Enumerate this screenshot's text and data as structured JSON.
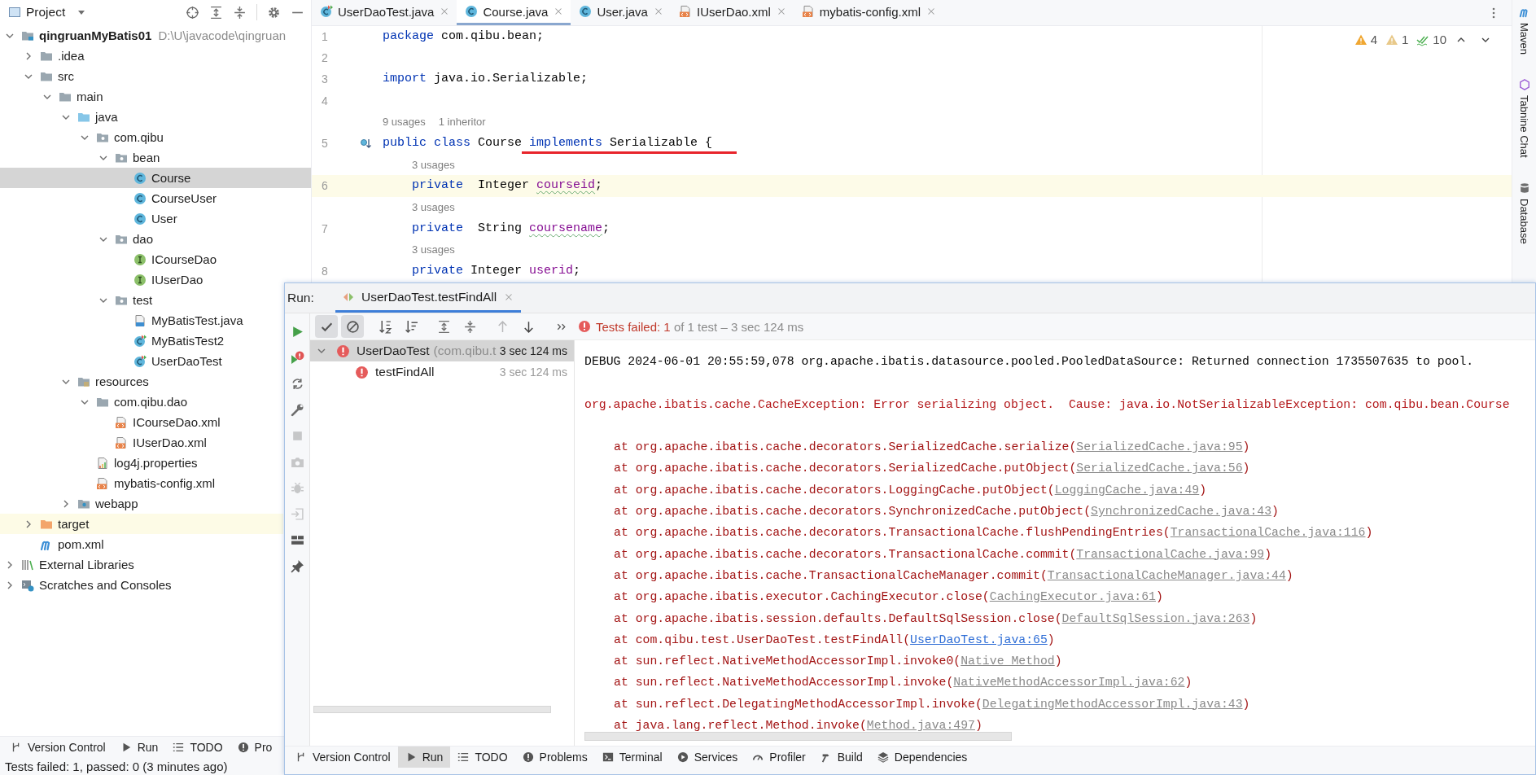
{
  "project_panel": {
    "title": "Project",
    "tree": [
      {
        "label": "qingruanMyBatis01",
        "hint": "D:\\U\\javacode\\qingruan",
        "kind": "module",
        "expanded": true,
        "selected": false,
        "highlighted": false,
        "children": [
          {
            "label": ".idea",
            "kind": "folder",
            "expanded": false,
            "selected": false,
            "highlighted": false
          },
          {
            "label": "src",
            "kind": "folder",
            "expanded": true,
            "selected": false,
            "highlighted": false,
            "children": [
              {
                "label": "main",
                "kind": "folder",
                "expanded": true,
                "selected": false,
                "highlighted": false,
                "children": [
                  {
                    "label": "java",
                    "kind": "source",
                    "expanded": true,
                    "selected": false,
                    "highlighted": false,
                    "children": [
                      {
                        "label": "com.qibu",
                        "kind": "package",
                        "expanded": true,
                        "selected": false,
                        "highlighted": false,
                        "children": [
                          {
                            "label": "bean",
                            "kind": "package",
                            "expanded": true,
                            "selected": false,
                            "highlighted": false,
                            "children": [
                              {
                                "label": "Course",
                                "kind": "class",
                                "selected": true,
                                "highlighted": false
                              },
                              {
                                "label": "CourseUser",
                                "kind": "class",
                                "selected": false,
                                "highlighted": false
                              },
                              {
                                "label": "User",
                                "kind": "class",
                                "selected": false,
                                "highlighted": false
                              }
                            ]
                          },
                          {
                            "label": "dao",
                            "kind": "package",
                            "expanded": true,
                            "selected": false,
                            "highlighted": false,
                            "children": [
                              {
                                "label": "ICourseDao",
                                "kind": "interface",
                                "selected": false,
                                "highlighted": false
                              },
                              {
                                "label": "IUserDao",
                                "kind": "interface",
                                "selected": false,
                                "highlighted": false
                              }
                            ]
                          },
                          {
                            "label": "test",
                            "kind": "package",
                            "expanded": true,
                            "selected": false,
                            "highlighted": false,
                            "children": [
                              {
                                "label": "MyBatisTest.java",
                                "kind": "java-file",
                                "selected": false,
                                "highlighted": false
                              },
                              {
                                "label": "MyBatisTest2",
                                "kind": "test-class",
                                "selected": false,
                                "highlighted": false
                              },
                              {
                                "label": "UserDaoTest",
                                "kind": "test-class",
                                "selected": false,
                                "highlighted": false
                              }
                            ]
                          }
                        ]
                      }
                    ]
                  },
                  {
                    "label": "resources",
                    "kind": "resources",
                    "expanded": true,
                    "selected": false,
                    "highlighted": false,
                    "children": [
                      {
                        "label": "com.qibu.dao",
                        "kind": "folder",
                        "expanded": true,
                        "selected": false,
                        "highlighted": false,
                        "children": [
                          {
                            "label": "ICourseDao.xml",
                            "kind": "xml",
                            "selected": false,
                            "highlighted": false
                          },
                          {
                            "label": "IUserDao.xml",
                            "kind": "xml",
                            "selected": false,
                            "highlighted": false
                          }
                        ]
                      },
                      {
                        "label": "log4j.properties",
                        "kind": "properties",
                        "selected": false,
                        "highlighted": false
                      },
                      {
                        "label": "mybatis-config.xml",
                        "kind": "xml",
                        "selected": false,
                        "highlighted": false
                      }
                    ]
                  },
                  {
                    "label": "webapp",
                    "kind": "web",
                    "expanded": false,
                    "selected": false,
                    "highlighted": false
                  }
                ]
              }
            ]
          },
          {
            "label": "target",
            "kind": "excluded",
            "expanded": false,
            "selected": false,
            "highlighted": true
          },
          {
            "label": "pom.xml",
            "kind": "maven",
            "selected": false,
            "highlighted": false
          }
        ]
      },
      {
        "label": "External Libraries",
        "kind": "libraries",
        "expanded": false,
        "selected": false,
        "highlighted": false
      },
      {
        "label": "Scratches and Consoles",
        "kind": "scratches",
        "expanded": false,
        "selected": false,
        "highlighted": false
      }
    ]
  },
  "editor": {
    "tabs": [
      {
        "label": "UserDaoTest.java",
        "kind": "test-class",
        "selected": false
      },
      {
        "label": "Course.java",
        "kind": "class",
        "selected": true
      },
      {
        "label": "User.java",
        "kind": "class",
        "selected": false
      },
      {
        "label": "IUserDao.xml",
        "kind": "xml",
        "selected": false
      },
      {
        "label": "mybatis-config.xml",
        "kind": "xml",
        "selected": false
      }
    ],
    "rows": [
      {
        "kind": "code",
        "number": "1",
        "current": false,
        "marker": false,
        "tokens": [
          {
            "text": "package",
            "kind": "keyword"
          },
          {
            "text": " com.qibu.bean;",
            "kind": "plain"
          }
        ]
      },
      {
        "kind": "code",
        "number": "2",
        "current": false,
        "marker": false
      },
      {
        "kind": "code",
        "number": "3",
        "current": false,
        "marker": false,
        "tokens": [
          {
            "text": "import",
            "kind": "keyword"
          },
          {
            "text": " java.io.Serializable;",
            "kind": "plain"
          }
        ]
      },
      {
        "kind": "code",
        "number": "4",
        "current": false,
        "marker": false
      },
      {
        "kind": "hint",
        "parts": [
          "9 usages",
          "1 inheritor"
        ]
      },
      {
        "kind": "code",
        "number": "5",
        "current": false,
        "marker": true,
        "tokens": [
          {
            "text": "public class",
            "kind": "keyword"
          },
          {
            "text": " Course",
            "kind": "plain"
          }
        ],
        "marked_tokens": [
          {
            "text": " implements",
            "kind": "keyword"
          },
          {
            "text": " Serializable {",
            "kind": "plain"
          }
        ],
        "children": [
          {
            "kind": "hint",
            "parts": [
              "3 usages"
            ]
          },
          {
            "kind": "code",
            "number": "6",
            "current": true,
            "marker": false,
            "tokens": [
              {
                "text": "private",
                "kind": "keyword"
              },
              {
                "text": "  Integer ",
                "kind": "plain"
              },
              {
                "text": "courseid",
                "kind": "field-typo"
              },
              {
                "text": ";",
                "kind": "plain"
              }
            ]
          },
          {
            "kind": "hint",
            "parts": [
              "3 usages"
            ]
          },
          {
            "kind": "code",
            "number": "7",
            "current": false,
            "marker": false,
            "tokens": [
              {
                "text": "private",
                "kind": "keyword"
              },
              {
                "text": "  String ",
                "kind": "plain"
              },
              {
                "text": "coursename",
                "kind": "field-typo"
              },
              {
                "text": ";",
                "kind": "plain"
              }
            ]
          },
          {
            "kind": "hint",
            "parts": [
              "3 usages"
            ]
          },
          {
            "kind": "code",
            "number": "8",
            "current": false,
            "marker": false,
            "tokens": [
              {
                "text": "private",
                "kind": "keyword"
              },
              {
                "text": " Integer ",
                "kind": "plain"
              },
              {
                "text": "userid",
                "kind": "field"
              },
              {
                "text": ";",
                "kind": "plain"
              }
            ]
          }
        ]
      }
    ],
    "inspections": {
      "warnings": "4",
      "weak_warnings": "1",
      "passed": "10"
    }
  },
  "right_strip": [
    {
      "label": "Maven",
      "kind": "maven"
    },
    {
      "label": "Tabnine Chat",
      "kind": "tabnine"
    },
    {
      "label": "Database",
      "kind": "database"
    }
  ],
  "run_window": {
    "title": "Run:",
    "tab": {
      "label": "UserDaoTest.testFindAll",
      "selected": true
    },
    "side_tools": [
      {
        "kind": "run",
        "disabled": false
      },
      {
        "kind": "rerun-failed",
        "disabled": false
      },
      {
        "kind": "toggle-auto",
        "disabled": false
      },
      {
        "kind": "wrench",
        "disabled": false
      },
      {
        "kind": "stop",
        "disabled": true
      },
      {
        "kind": "camera",
        "disabled": true
      },
      {
        "kind": "bug",
        "disabled": true
      },
      {
        "kind": "import",
        "disabled": true
      },
      {
        "kind": "layout",
        "disabled": false
      },
      {
        "kind": "pin",
        "disabled": false
      }
    ],
    "test_tools": [
      {
        "kind": "check",
        "on": true,
        "disabled": false
      },
      {
        "kind": "cancel",
        "on": true,
        "disabled": false
      },
      {
        "kind": "sort-alpha",
        "on": false,
        "disabled": false
      },
      {
        "kind": "sort-duration",
        "on": false,
        "disabled": false
      },
      {
        "kind": "expand-all",
        "on": false,
        "disabled": false
      },
      {
        "kind": "collapse-all",
        "on": false,
        "disabled": false
      },
      {
        "kind": "up",
        "on": false,
        "disabled": true
      },
      {
        "kind": "down",
        "on": false,
        "disabled": false
      },
      {
        "kind": "more",
        "on": false,
        "disabled": false
      }
    ],
    "status": {
      "failed": "Tests failed: 1",
      "summary": "of 1 test – 3 sec 124 ms"
    },
    "tests": [
      {
        "name": "UserDaoTest",
        "package": "(com.qibu.t",
        "time": "3 sec 124 ms",
        "failed": true,
        "expanded": true,
        "selected": true,
        "children": [
          {
            "name": "testFindAll",
            "time": "3 sec 124 ms",
            "failed": true,
            "selected": false
          }
        ]
      }
    ],
    "console": [
      {
        "kind": "debug",
        "text": "DEBUG 2024-06-01 20:55:59,078 org.apache.ibatis.datasource.pooled.PooledDataSource: Returned connection 1735507635 to pool."
      },
      {
        "kind": "blank"
      },
      {
        "kind": "error",
        "text": "org.apache.ibatis.cache.CacheException: Error serializing object.  Cause: java.io.NotSerializableException: com.qibu.bean.Course"
      },
      {
        "kind": "blank"
      },
      {
        "kind": "trace",
        "text": "at org.apache.ibatis.cache.decorators.SerializedCache.serialize(",
        "link": "SerializedCache.java:95",
        "close": ")",
        "project": false
      },
      {
        "kind": "trace",
        "text": "at org.apache.ibatis.cache.decorators.SerializedCache.putObject(",
        "link": "SerializedCache.java:56",
        "close": ")",
        "project": false
      },
      {
        "kind": "trace",
        "text": "at org.apache.ibatis.cache.decorators.LoggingCache.putObject(",
        "link": "LoggingCache.java:49",
        "close": ")",
        "project": false
      },
      {
        "kind": "trace",
        "text": "at org.apache.ibatis.cache.decorators.SynchronizedCache.putObject(",
        "link": "SynchronizedCache.java:43",
        "close": ")",
        "project": false
      },
      {
        "kind": "trace",
        "text": "at org.apache.ibatis.cache.decorators.TransactionalCache.flushPendingEntries(",
        "link": "TransactionalCache.java:116",
        "close": ")",
        "project": false
      },
      {
        "kind": "trace",
        "text": "at org.apache.ibatis.cache.decorators.TransactionalCache.commit(",
        "link": "TransactionalCache.java:99",
        "close": ")",
        "project": false
      },
      {
        "kind": "trace",
        "text": "at org.apache.ibatis.cache.TransactionalCacheManager.commit(",
        "link": "TransactionalCacheManager.java:44",
        "close": ")",
        "project": false
      },
      {
        "kind": "trace",
        "text": "at org.apache.ibatis.executor.CachingExecutor.close(",
        "link": "CachingExecutor.java:61",
        "close": ")",
        "project": false
      },
      {
        "kind": "trace",
        "text": "at org.apache.ibatis.session.defaults.DefaultSqlSession.close(",
        "link": "DefaultSqlSession.java:263",
        "close": ")",
        "project": false
      },
      {
        "kind": "trace",
        "text": "at com.qibu.test.UserDaoTest.testFindAll(",
        "link": "UserDaoTest.java:65",
        "close": ")",
        "project": true
      },
      {
        "kind": "trace",
        "text": "at sun.reflect.NativeMethodAccessorImpl.invoke0(",
        "link": "Native Method",
        "close": ")",
        "project": false
      },
      {
        "kind": "trace",
        "text": "at sun.reflect.NativeMethodAccessorImpl.invoke(",
        "link": "NativeMethodAccessorImpl.java:62",
        "close": ")",
        "project": false
      },
      {
        "kind": "trace",
        "text": "at sun.reflect.DelegatingMethodAccessorImpl.invoke(",
        "link": "DelegatingMethodAccessorImpl.java:43",
        "close": ")",
        "project": false
      },
      {
        "kind": "trace",
        "text": "at java.lang.reflect.Method.invoke(",
        "link": "Method.java:497",
        "close": ")",
        "project": false
      }
    ],
    "tool_bar": [
      {
        "label": "Version Control",
        "kind": "branch",
        "selected": false
      },
      {
        "label": "Run",
        "kind": "play",
        "selected": true
      },
      {
        "label": "TODO",
        "kind": "list",
        "selected": false
      },
      {
        "label": "Problems",
        "kind": "problems",
        "selected": false
      },
      {
        "label": "Terminal",
        "kind": "terminal",
        "selected": false
      },
      {
        "label": "Services",
        "kind": "services",
        "selected": false
      },
      {
        "label": "Profiler",
        "kind": "profiler",
        "selected": false
      },
      {
        "label": "Build",
        "kind": "hammer",
        "selected": false
      },
      {
        "label": "Dependencies",
        "kind": "layers",
        "selected": false
      }
    ]
  },
  "background_tool_bar": [
    {
      "label": "Version Control",
      "kind": "branch",
      "selected": false
    },
    {
      "label": "Run",
      "kind": "play",
      "selected": false
    },
    {
      "label": "TODO",
      "kind": "list",
      "selected": false
    },
    {
      "label": "Pro",
      "kind": "problems",
      "selected": false
    }
  ],
  "status_bar": {
    "text": "Tests failed: 1, passed: 0 (3 minutes ago)"
  }
}
